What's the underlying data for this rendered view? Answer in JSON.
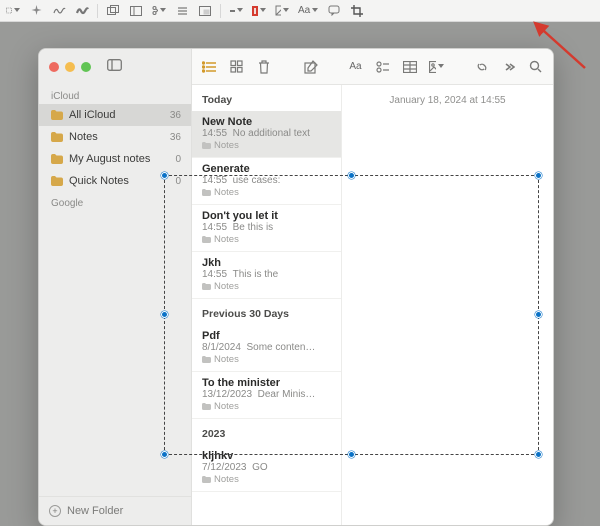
{
  "screenshot_toolbar": {
    "marker_label": "Aa",
    "crop_highlighted": true
  },
  "window": {
    "sidebar": {
      "sections": [
        {
          "label": "iCloud",
          "items": [
            {
              "label": "All iCloud",
              "count": "36",
              "selected": true
            },
            {
              "label": "Notes",
              "count": "36",
              "selected": false
            },
            {
              "label": "My August notes",
              "count": "0",
              "selected": false
            },
            {
              "label": "Quick Notes",
              "count": "0",
              "selected": false
            }
          ]
        },
        {
          "label": "Google",
          "items": []
        }
      ],
      "footer": "New Folder"
    },
    "notelist": {
      "groups": [
        {
          "label": "Today",
          "notes": [
            {
              "title": "New Note",
              "time": "14:55",
              "preview": "No additional text",
              "folder": "Notes",
              "selected": true
            },
            {
              "title": "Generate",
              "time": "14:55",
              "preview": "use cases:",
              "folder": "Notes"
            },
            {
              "title": "Don't you let it",
              "time": "14:55",
              "preview": "Be this is",
              "folder": "Notes"
            },
            {
              "title": "Jkh",
              "time": "14:55",
              "preview": "This is the",
              "folder": "Notes"
            }
          ]
        },
        {
          "label": "Previous 30 Days",
          "notes": [
            {
              "title": "Pdf",
              "time": "8/1/2024",
              "preview": "Some conten…",
              "folder": "Notes"
            },
            {
              "title": "To the minister",
              "time": "13/12/2023",
              "preview": "Dear Minis…",
              "folder": "Notes"
            }
          ]
        },
        {
          "label": "2023",
          "notes": [
            {
              "title": "kljhkv",
              "time": "7/12/2023",
              "preview": "GO",
              "folder": "Notes"
            }
          ]
        }
      ]
    },
    "editor": {
      "timestamp": "January 18, 2024 at 14:55"
    }
  }
}
